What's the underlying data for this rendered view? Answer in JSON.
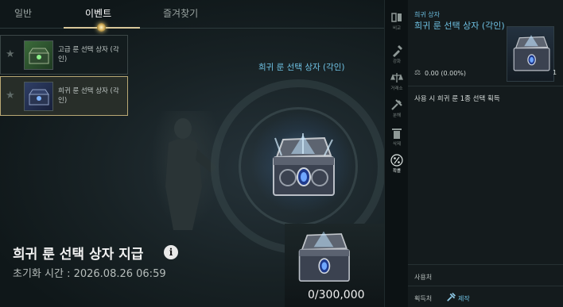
{
  "tabs": [
    {
      "label": "일반"
    },
    {
      "label": "이벤트"
    },
    {
      "label": "즐겨찾기"
    }
  ],
  "list": {
    "items": [
      {
        "name": "고급 룬 선택 상자 (각인)",
        "thumb_color": "#3b6b3a"
      },
      {
        "name": "희귀 룬 선택 상자 (각인)",
        "thumb_color": "#2f3f66"
      }
    ]
  },
  "preview": {
    "title": "희귀 룬 선택 상자 (각인)"
  },
  "reward": {
    "title": "희귀 룬 선택 상자 지급",
    "info_glyph": "i",
    "reset_time": "초기화 시간 : 2026.08.26 06:59",
    "progress": "0/300,000"
  },
  "side_menu": [
    {
      "label": "비교",
      "icon": "compare-icon"
    },
    {
      "label": "강화",
      "icon": "enhance-icon"
    },
    {
      "label": "거래소",
      "icon": "exchange-icon"
    },
    {
      "label": "분해",
      "icon": "dismantle-icon"
    },
    {
      "label": "삭제",
      "icon": "trash-icon"
    },
    {
      "label": "확률",
      "icon": "probability-icon"
    }
  ],
  "detail": {
    "type": "희귀 상자",
    "name": "희귀 룬 선택 상자 (각인)",
    "count": "1",
    "weight": "0.00 (0.00%)",
    "description": "사용 시 희귀 룬 1종 선택 획득",
    "use_label": "사용처",
    "acquire_label": "획득처",
    "acquire_value": "제작"
  },
  "colors": {
    "accent_blue": "#6ec0e2",
    "tab_gold": "#d8c79a",
    "selected_border": "#b9a874"
  }
}
